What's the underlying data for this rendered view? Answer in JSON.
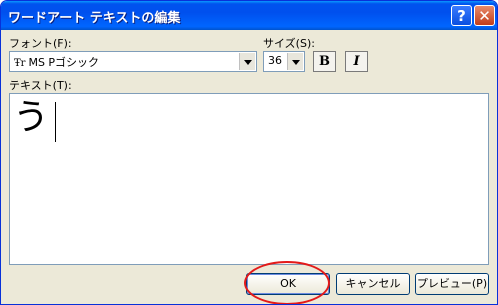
{
  "window": {
    "title": "ワードアート テキストの編集"
  },
  "titlebar": {
    "help_glyph": "?",
    "close_glyph": "✕"
  },
  "font": {
    "label": "フォント(F):",
    "value": "MS Pゴシック",
    "icon_glyph": "Ŧr"
  },
  "size": {
    "label": "サイズ(S):",
    "value": "36"
  },
  "format": {
    "bold_label": "B",
    "italic_label": "I"
  },
  "text": {
    "label": "テキスト(T):",
    "value": "う"
  },
  "buttons": {
    "ok": "OK",
    "cancel": "キャンセル",
    "preview": "プレビュー(P)"
  },
  "colors": {
    "title_bar": "#0053ee",
    "dialog_bg": "#ece9d8",
    "highlight_circle": "#e31a1a"
  }
}
